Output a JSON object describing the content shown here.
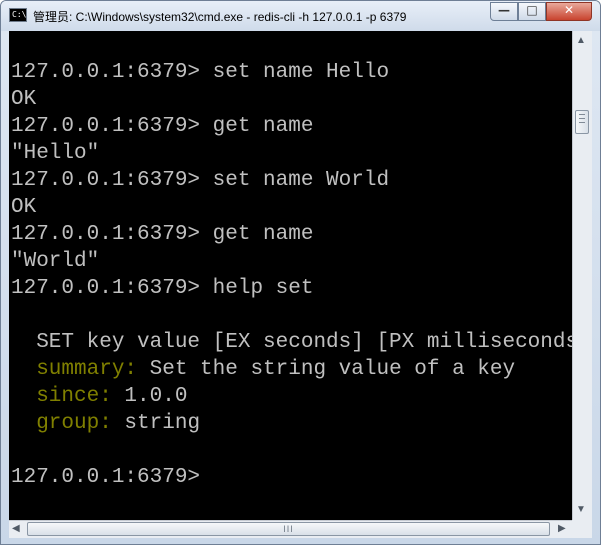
{
  "window": {
    "icon_text": "C:\\",
    "title": "管理员: C:\\Windows\\system32\\cmd.exe - redis-cli  -h 127.0.0.1 -p 6379",
    "minimize": "—",
    "maximize": "□",
    "close": "✕"
  },
  "console": {
    "prompt": "127.0.0.1:6379>",
    "lines": [
      {
        "text": "127.0.0.1:6379> set name Hello"
      },
      {
        "text": "OK"
      },
      {
        "text": "127.0.0.1:6379> get name"
      },
      {
        "text": "\"Hello\""
      },
      {
        "text": "127.0.0.1:6379> set name World"
      },
      {
        "text": "OK"
      },
      {
        "text": "127.0.0.1:6379> get name"
      },
      {
        "text": "\"World\""
      },
      {
        "text": "127.0.0.1:6379> help set"
      },
      {
        "text": ""
      },
      {
        "text": "  SET key value [EX seconds] [PX milliseconds] [NX|XX]"
      },
      {
        "label": "  summary:",
        "text": " Set the string value of a key"
      },
      {
        "label": "  since:",
        "text": " 1.0.0"
      },
      {
        "label": "  group:",
        "text": " string"
      },
      {
        "text": ""
      },
      {
        "text": "127.0.0.1:6379>"
      }
    ]
  },
  "scrollbars": {
    "up_arrow": "▲",
    "down_arrow": "▼",
    "left_arrow": "◀",
    "right_arrow": "▶",
    "grip": "III"
  },
  "colors": {
    "console_bg": "#000000",
    "console_text": "#c0c0c0",
    "help_label": "#808000"
  }
}
